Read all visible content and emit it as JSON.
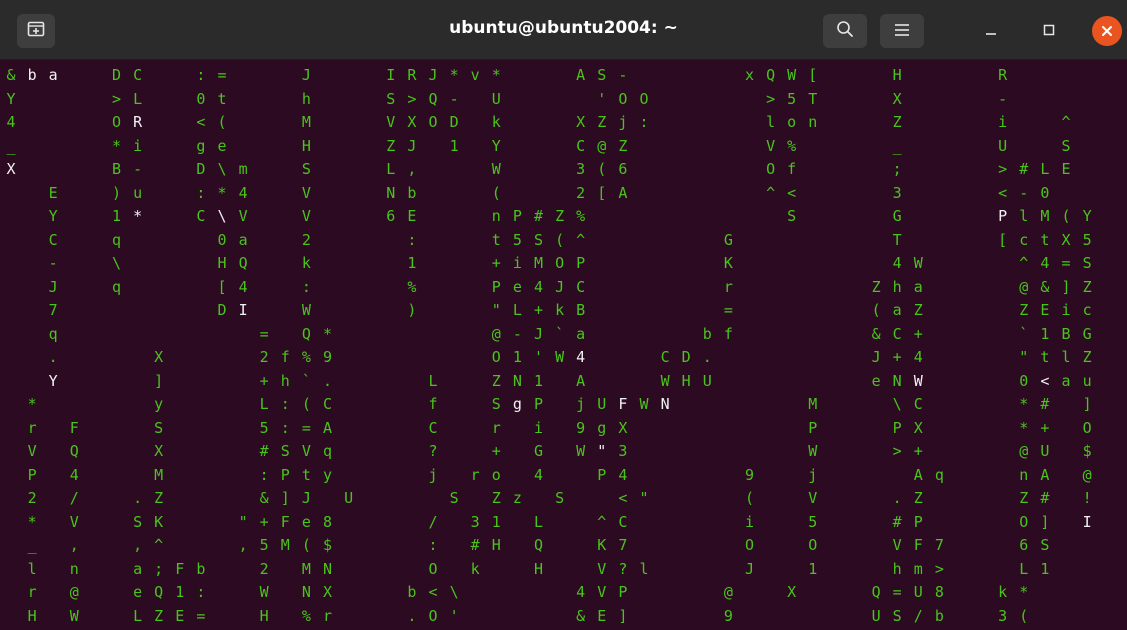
{
  "window": {
    "title": "ubuntu@ubuntu2004: ~"
  },
  "colors": {
    "terminal_bg": "#2c0a22",
    "matrix_green": "#49c41b",
    "matrix_head": "#f2f2f2",
    "titlebar_bg": "#2b2b2b",
    "close_orange": "#e95420"
  },
  "icons": {
    "new_tab": "new-tab-icon",
    "search": "search-icon",
    "menu": "hamburger-menu-icon",
    "minimize": "minimize-icon",
    "maximize": "maximize-icon",
    "close": "close-icon"
  },
  "terminal": {
    "rows": [
      "&ba  DC  :=   J   IRJ*v*   AS-     xQW[   H    R    ",
      "Y    >L  0t   h   S>Q- U    'OO     >5T   X    -    ",
      "4    OR  <(   M   VXOD k   XZj:     lon   Z    i  ^ ",
      "_    *i  ge   H   ZJ 1 Y   C@Z      V%    _    U  S ",
      "X    B-  D\\m  S   L,   W   3(6      Of    ;    >#LE",
      "  E  )u  :*4  V   Nb   (   2[A      ^<    3    <-0 ",
      "  Y  1*  C\\V  V   6E   nP#Z%         S    G    PlM(Y",
      "  C  q    0a  2    :   t5S(^      G       T    [ctX5",
      "  -  \\    HQ  k    1   +iMOP      K       4W    ^4=S",
      "  J  q    [4  :    %   Pe4JC      r      Zha    @&]Z",
      "  7       DI  W    )   \"L+kB      =      (aZ    ZEic",
      "  q         = Q*       @-J`a     bf      &C+    `1BG",
      "  .    X    2f%9       O1'W4   CD.       J+4    \"tlZ",
      "  Y    ]    +h`.    L  ZN1 A   WHU       eNW    0<au",
      " *     y    L:(C    f  SgP jUFWN      M   \\C    *# ]",
      " r F   S    5:=A    C  r i 9gX        P   PX    *+ O",
      " V Q   X    #SVq    ?  + G W\"3        W   >+    @U $",
      " P 4   M    :Pty    j ro 4  P4     9  j    Aq   nA @",
      " 2 /  .Z    &]J U    S Zz S  <\"    (  V   .Z    Z# !",
      " * V  SK   \"+Fe8    / 31 L  ^C     i  5   #P    O] I",
      " _ ,  ,^   ,5M($    : #H Q  K7     O  O   VF7   6S  ",
      " l n  a;Fb  2 MN    O k  H  V?l    J  1   hm>   L1  ",
      " r @  eQ1:  W NX   b<\\     4VP    @  X   Q=U8  k*  ",
      " H W  LZE=  H %r   .O'     &E]    9      US/b  3(  "
    ]
  }
}
